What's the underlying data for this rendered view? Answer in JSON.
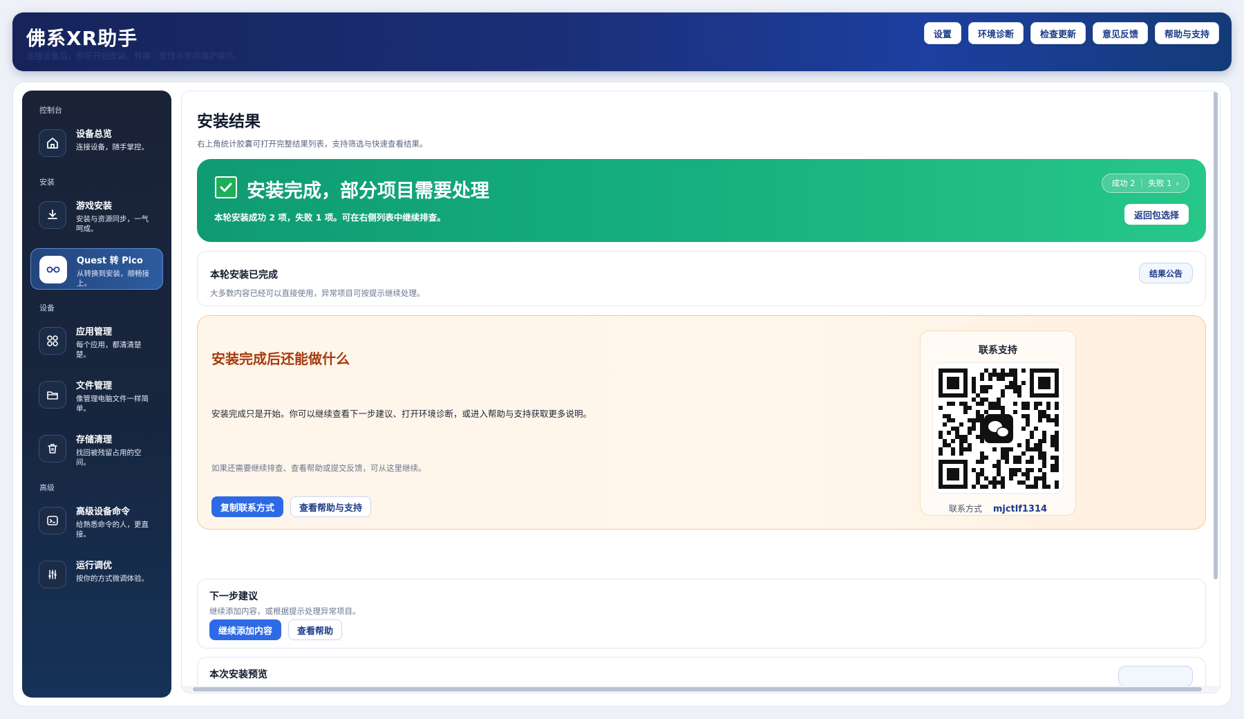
{
  "header": {
    "title": "佛系XR助手",
    "subtitle": "连接设备后，即可开始安装、转换、管理与常用维护操作。",
    "actions": [
      "设置",
      "环境诊断",
      "检查更新",
      "意见反馈",
      "帮助与支持"
    ]
  },
  "sidebar": {
    "sections": {
      "console": "控制台",
      "install": "安装",
      "device": "设备",
      "advanced": "高级"
    },
    "items": [
      {
        "label": "设备总览",
        "desc": "连接设备，随手掌控。",
        "icon": "home-icon"
      },
      {
        "label": "游戏安装",
        "desc": "安装与资源同步，一气呵成。",
        "icon": "download-icon"
      },
      {
        "label": "Quest 转 Pico",
        "desc": "从转换到安装，顺畅接上。",
        "icon": "vr-headset-icon"
      },
      {
        "label": "应用管理",
        "desc": "每个应用，都清清楚楚。",
        "icon": "apps-grid-icon"
      },
      {
        "label": "文件管理",
        "desc": "像管理电脑文件一样简单。",
        "icon": "folder-icon"
      },
      {
        "label": "存储清理",
        "desc": "找回被残留占用的空间。",
        "icon": "trash-icon"
      },
      {
        "label": "高级设备命令",
        "desc": "给熟悉命令的人，更直接。",
        "icon": "terminal-icon"
      },
      {
        "label": "运行调优",
        "desc": "按你的方式微调体验。",
        "icon": "sliders-icon"
      }
    ]
  },
  "main": {
    "title": "安装结果",
    "subtitle": "右上角统计胶囊可打开完整结果列表，支持筛选与快速查看结果。",
    "banner": {
      "title": "安装完成，部分项目需要处理",
      "desc": "本轮安装成功 2 项，失败 1 项。可在右侧列表中继续排查。",
      "stats": "成功 2 ｜ 失败 1",
      "stats_arrow": "›",
      "back_button": "返回包选择"
    },
    "done_card": {
      "title": "本轮安装已完成",
      "desc": "大多数内容已经可以直接使用，异常项目可按提示继续处理。",
      "pill": "结果公告"
    },
    "next_what": {
      "title": "安装完成后还能做什么",
      "desc": "安装完成只是开始。你可以继续查看下一步建议、打开环境诊断，或进入帮助与支持获取更多说明。",
      "hint": "如果还需要继续排查、查看帮助或提交反馈，可从这里继续。",
      "primary": "复制联系方式",
      "secondary": "查看帮助与支持"
    },
    "support": {
      "title": "联系支持",
      "contact_label": "联系方式",
      "contact_value": "mjctlf1314"
    },
    "suggest": {
      "title": "下一步建议",
      "desc": "继续添加内容，或根据提示处理异常项目。",
      "primary": "继续添加内容",
      "secondary": "查看帮助"
    },
    "preview": {
      "title": "本次安装预览"
    }
  },
  "colors": {
    "accent": "#2e6ae6",
    "success_banner": "#16b07e",
    "warning_title": "#a63a0e",
    "sidebar_bg": "#1a2236"
  }
}
